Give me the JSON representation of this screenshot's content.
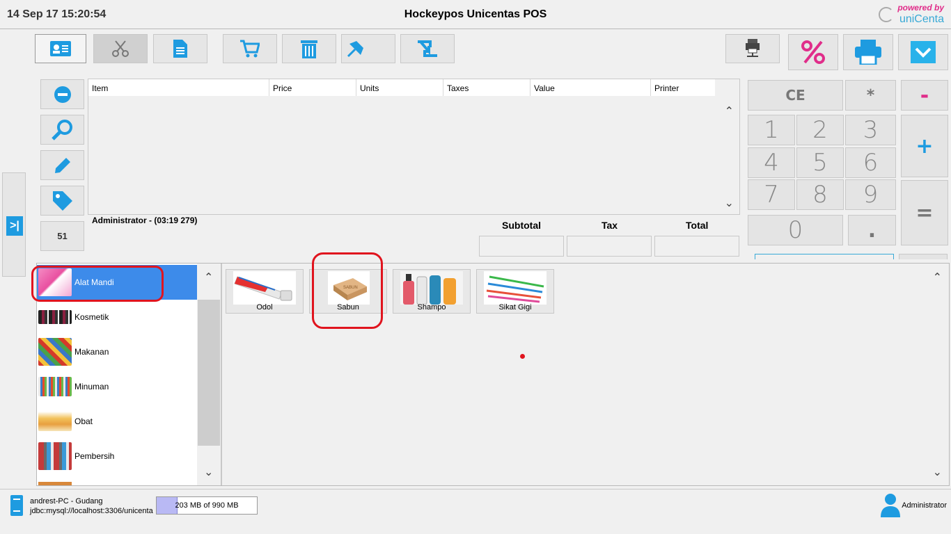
{
  "header": {
    "datetime": "14 Sep 17 15:20:54",
    "title": "Hockeypos Unicentas POS",
    "brand_tagline": "powered by",
    "brand_name": "uniCenta"
  },
  "colors": {
    "accent_blue": "#1e9be0",
    "accent_pink": "#e02d8a",
    "selected_category": "#3d8bea",
    "annotation_red": "#e0141e"
  },
  "toolbar": {
    "left_icons": [
      "customer-card-icon",
      "scissors-icon",
      "document-icon",
      "cart-icon",
      "trash-icon",
      "pin-icon",
      "transfer-icon"
    ],
    "right_icons": [
      "printer-network-icon",
      "percent-icon",
      "printer-icon",
      "chevron-down-icon"
    ]
  },
  "left_panel": {
    "icons": [
      "minus-icon",
      "search-icon",
      "pencil-icon",
      "tag-icon"
    ],
    "count": "51"
  },
  "ticket": {
    "columns": [
      "Item",
      "Price",
      "Units",
      "Taxes",
      "Value",
      "Printer"
    ],
    "user_line": "Administrator - (03:19 279)",
    "subtotal_label": "Subtotal",
    "tax_label": "Tax",
    "total_label": "Total"
  },
  "keypad": {
    "ce": "CE",
    "mult": "*",
    "minus": "-",
    "plus": "+",
    "equals": "=",
    "dot": ".",
    "digits": [
      "1",
      "2",
      "3",
      "4",
      "5",
      "6",
      "7",
      "8",
      "9",
      "0"
    ]
  },
  "categories": [
    {
      "label": "Alat Mandi",
      "selected": true
    },
    {
      "label": "Kosmetik"
    },
    {
      "label": "Makanan"
    },
    {
      "label": "Minuman"
    },
    {
      "label": "Obat"
    },
    {
      "label": "Pembersih"
    }
  ],
  "products": [
    {
      "label": "Odol"
    },
    {
      "label": "Sabun",
      "image_text": "SABUN"
    },
    {
      "label": "Shampo"
    },
    {
      "label": "Sikat Gigi"
    }
  ],
  "status": {
    "host": "andrest-PC - Gudang",
    "db": "jdbc:mysql://localhost:3306/unicenta",
    "memory": "203 MB of 990 MB",
    "memory_used_fraction": 0.205,
    "user": "Administrator"
  }
}
